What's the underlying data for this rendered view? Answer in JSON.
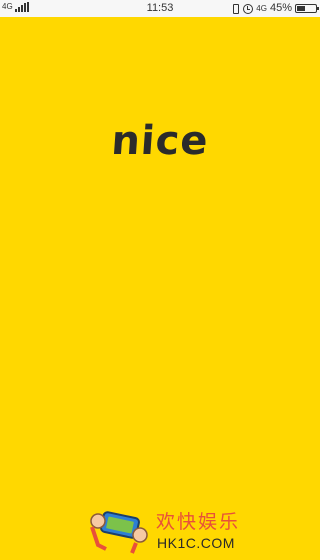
{
  "status_bar": {
    "network_left": "4G",
    "time": "11:53",
    "network_right": "4G",
    "battery_percent_label": "45%",
    "battery_level": 0.45
  },
  "splash": {
    "logo_text": "nice"
  },
  "watermark": {
    "title": "欢快娱乐",
    "url": "HK1C.COM"
  },
  "colors": {
    "background": "#ffd800",
    "logo": "#2b2b2b",
    "watermark_title": "#e8503a"
  }
}
